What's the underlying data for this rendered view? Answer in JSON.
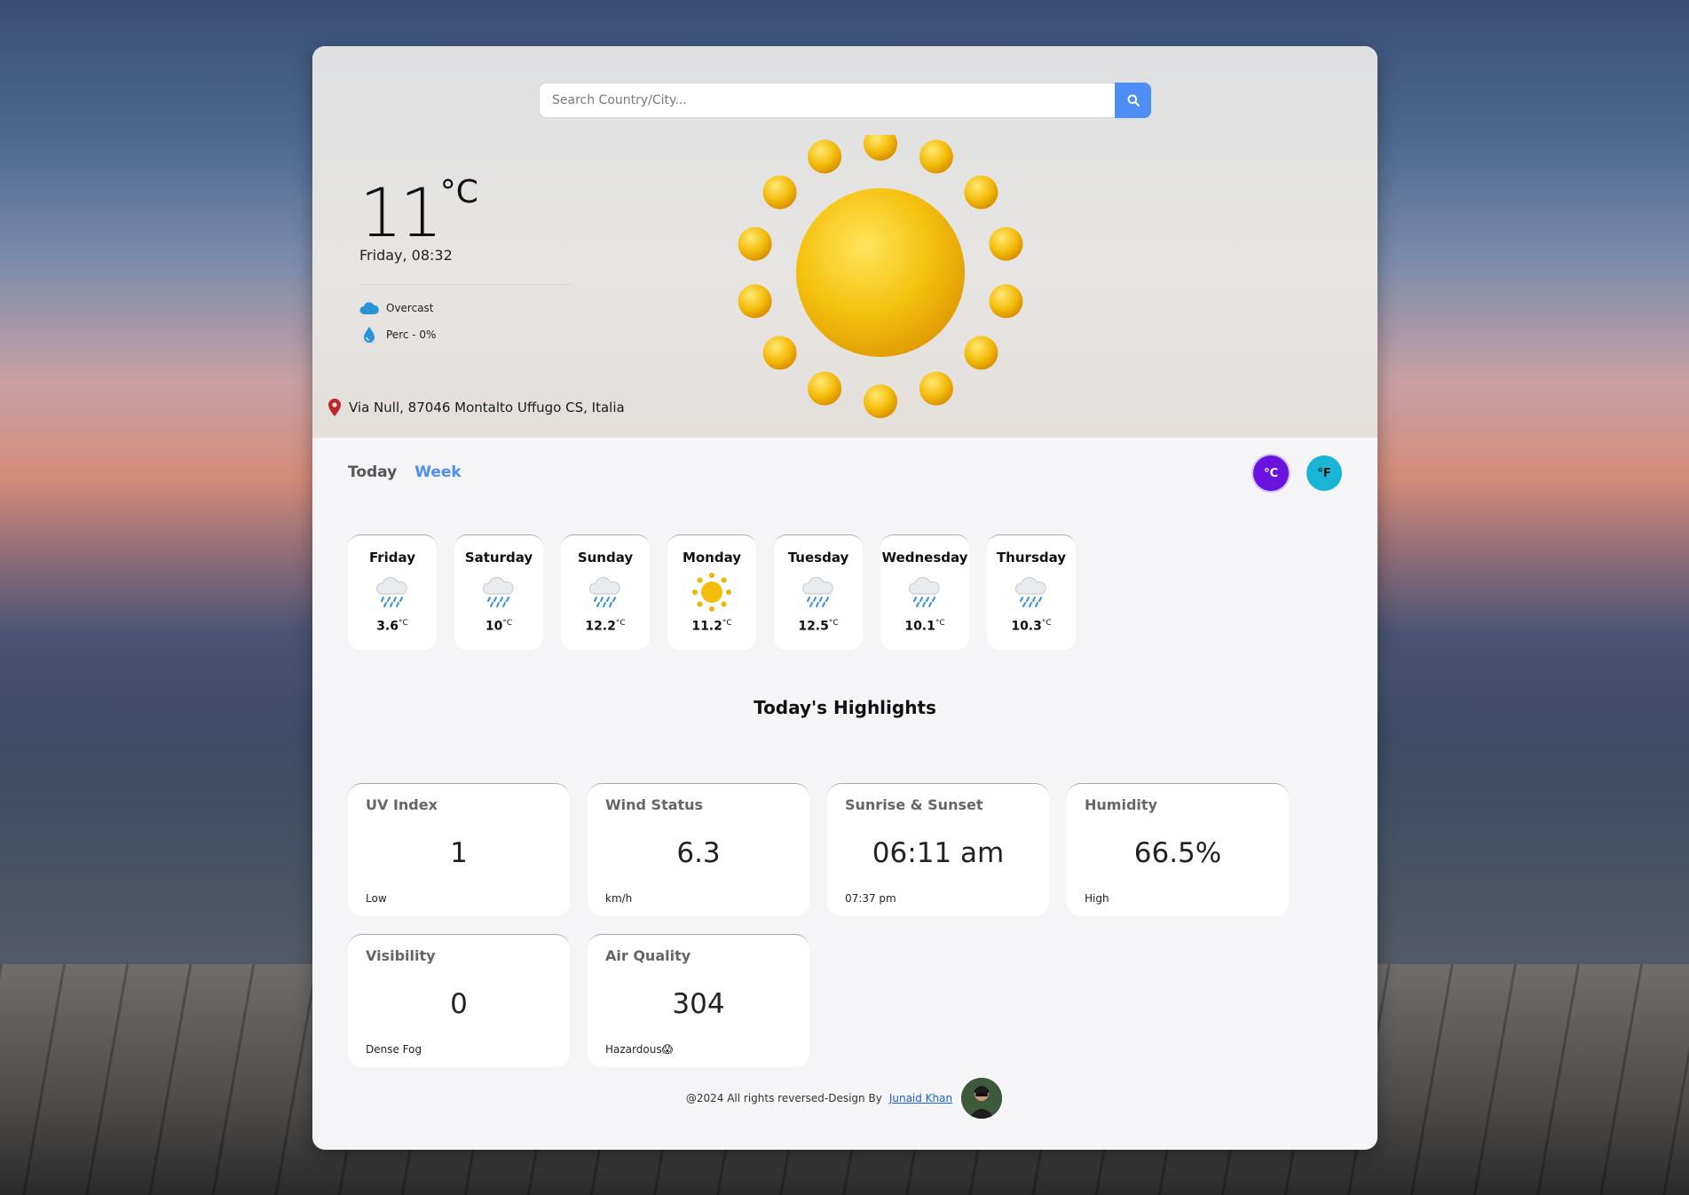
{
  "search": {
    "placeholder": "Search Country/City..."
  },
  "current": {
    "temperature": "11",
    "unit": "°C",
    "datetime": "Friday, 08:32",
    "condition": "Overcast",
    "precipitation": "Perc - 0%",
    "location": "Via Null, 87046 Montalto Uffugo CS, Italia"
  },
  "tabs": {
    "today": "Today",
    "week": "Week"
  },
  "unit_buttons": {
    "celsius": "°C",
    "fahrenheit": "°F"
  },
  "week": [
    {
      "day": "Friday",
      "temp": "3.6",
      "unit": "°C",
      "icon": "rain-cloud-icon"
    },
    {
      "day": "Saturday",
      "temp": "10",
      "unit": "°C",
      "icon": "rain-cloud-icon"
    },
    {
      "day": "Sunday",
      "temp": "12.2",
      "unit": "°C",
      "icon": "rain-cloud-icon"
    },
    {
      "day": "Monday",
      "temp": "11.2",
      "unit": "°C",
      "icon": "sun-icon"
    },
    {
      "day": "Tuesday",
      "temp": "12.5",
      "unit": "°C",
      "icon": "rain-cloud-icon"
    },
    {
      "day": "Wednesday",
      "temp": "10.1",
      "unit": "°C",
      "icon": "rain-cloud-icon"
    },
    {
      "day": "Thursday",
      "temp": "10.3",
      "unit": "°C",
      "icon": "rain-cloud-icon"
    }
  ],
  "highlights": {
    "title": "Today's Highlights",
    "cards": [
      {
        "label": "UV Index",
        "value": "1",
        "sub": "Low"
      },
      {
        "label": "Wind Status",
        "value": "6.3",
        "sub": "km/h"
      },
      {
        "label": "Sunrise & Sunset",
        "value": "06:11 am",
        "sub": "07:37 pm"
      },
      {
        "label": "Humidity",
        "value": "66.5%",
        "sub": "High"
      },
      {
        "label": "Visibility",
        "value": "0",
        "sub": "Dense Fog"
      },
      {
        "label": "Air Quality",
        "value": "304",
        "sub": "Hazardous😱"
      }
    ]
  },
  "footer": {
    "text": "@2024 All rights reversed-Design By",
    "author": "Junaid Khan"
  },
  "colors": {
    "accent": "#4c8df6",
    "celsius_btn": "#6a12e0",
    "fahrenheit_btn": "#19b4d6",
    "sun": "#f2b705"
  }
}
